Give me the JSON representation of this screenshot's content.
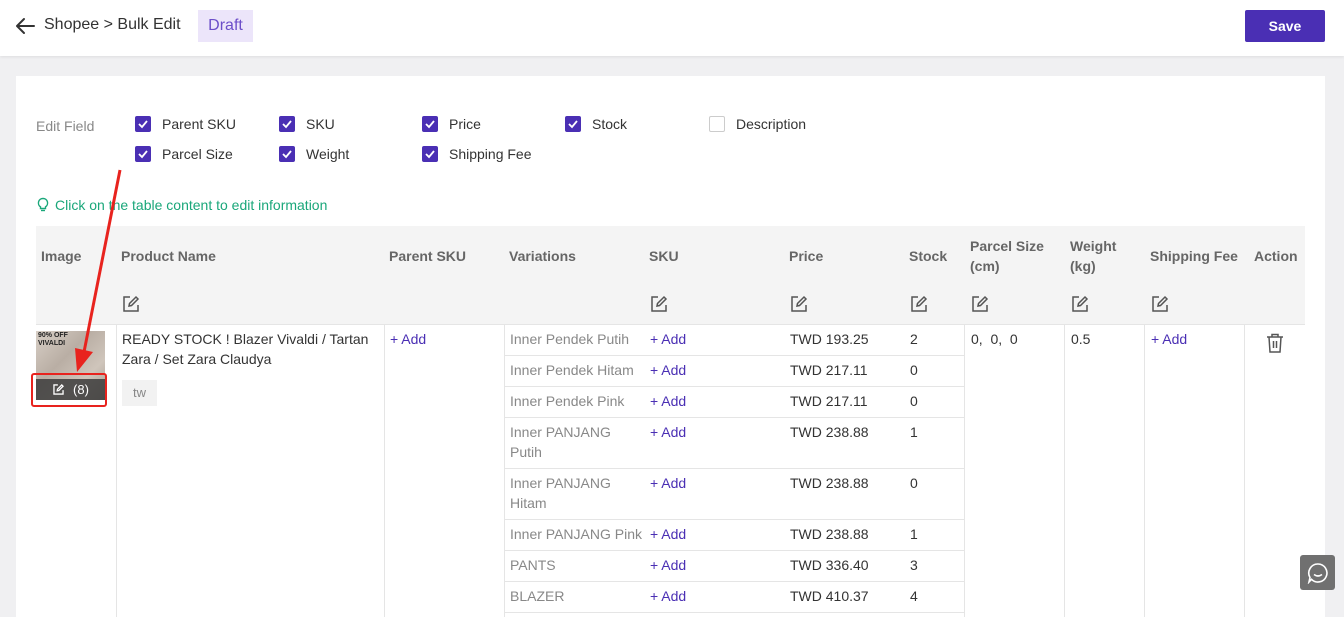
{
  "header": {
    "breadcrumb": "Shopee > Bulk Edit",
    "status_badge": "Draft",
    "save_label": "Save"
  },
  "edit_field": {
    "label": "Edit Field",
    "options": [
      {
        "label": "Parent SKU",
        "checked": true
      },
      {
        "label": "SKU",
        "checked": true
      },
      {
        "label": "Price",
        "checked": true
      },
      {
        "label": "Stock",
        "checked": true
      },
      {
        "label": "Description",
        "checked": false
      },
      {
        "label": "Parcel Size",
        "checked": true
      },
      {
        "label": "Weight",
        "checked": true
      },
      {
        "label": "Shipping Fee",
        "checked": true
      }
    ]
  },
  "tip": "Click on the table content to edit information",
  "table": {
    "headers": {
      "image": "Image",
      "product_name": "Product Name",
      "parent_sku": "Parent SKU",
      "variations": "Variations",
      "sku": "SKU",
      "price": "Price",
      "stock": "Stock",
      "parcel_size": "Parcel Size (cm)",
      "weight": "Weight (kg)",
      "shipping_fee": "Shipping Fee",
      "action": "Action"
    },
    "product": {
      "name": "READY STOCK ! Blazer Vivaldi / Tartan Zara / Set Zara Claudya",
      "tag": "tw",
      "image_count": "(8)",
      "image_text": "90% OFF VIVALDI",
      "parent_sku": "+ Add",
      "parcel_size": "0,  0,  0",
      "weight": "0.5",
      "shipping_fee": "+ Add"
    },
    "variations": [
      {
        "name": "Inner Pendek Putih",
        "sku": "+ Add",
        "price": "TWD 193.25",
        "stock": "2"
      },
      {
        "name": "Inner Pendek Hitam",
        "sku": "+ Add",
        "price": "TWD 217.11",
        "stock": "0"
      },
      {
        "name": "Inner Pendek Pink",
        "sku": "+ Add",
        "price": "TWD 217.11",
        "stock": "0"
      },
      {
        "name": "Inner PANJANG Putih",
        "sku": "+ Add",
        "price": "TWD 238.88",
        "stock": "1"
      },
      {
        "name": "Inner PANJANG Hitam",
        "sku": "+ Add",
        "price": "TWD 238.88",
        "stock": "0"
      },
      {
        "name": "Inner PANJANG Pink",
        "sku": "+ Add",
        "price": "TWD 238.88",
        "stock": "1"
      },
      {
        "name": "PANTS",
        "sku": "+ Add",
        "price": "TWD 336.40",
        "stock": "3"
      },
      {
        "name": "BLAZER",
        "sku": "+ Add",
        "price": "TWD 410.37",
        "stock": "4"
      }
    ]
  },
  "colors": {
    "accent": "#4a2fb4",
    "badge_bg": "#ece5fa",
    "tip": "#1aa77a",
    "annotation_red": "#e8231e"
  }
}
